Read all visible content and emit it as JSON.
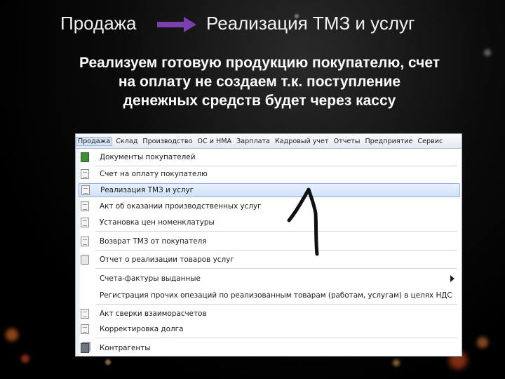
{
  "slide": {
    "header_left": "Продажа",
    "header_right": "Реализация ТМЗ и услуг",
    "subtitle_lines": [
      "Реализуем готовую продукцию покупателю, счет",
      "на оплату не создаем т.к. поступление",
      "денежных средств будет через кассу"
    ]
  },
  "colors": {
    "arrow": "#7b3fb0",
    "highlight": "#cfe0f7",
    "background": "#000000"
  },
  "menubar": {
    "items": [
      "Продажа",
      "Склад",
      "Производство",
      "ОС и НМА",
      "Зарплата",
      "Кадровый учет",
      "Отчеты",
      "Предприятие",
      "Сервис"
    ],
    "active_index": 0
  },
  "dropdown": {
    "items": [
      {
        "label": "Документы покупателей",
        "icon": "journal-icon"
      },
      {
        "label": "Счет на оплату покупателю",
        "icon": "document-icon"
      },
      {
        "label": "Реализация ТМЗ и услуг",
        "icon": "document-icon",
        "highlighted": true
      },
      {
        "label": "Акт об оказании производственных услуг",
        "icon": "document-icon"
      },
      {
        "label": "Установка цен номенклатуры",
        "icon": "document-icon"
      },
      {
        "label": "Возврат ТМЗ от покупателя",
        "icon": "document-icon"
      },
      {
        "label": "Отчет о реализации товаров услуг",
        "icon": "report-icon"
      },
      {
        "label": "Счета-фактуры выданные",
        "icon": "",
        "submenu": true
      },
      {
        "label": "Регистрация прочих опезаций по реализованным товарам (работам, услугам) в целях НДС",
        "icon": ""
      },
      {
        "label": "Акт сверки взаиморасчетов",
        "icon": "document-icon"
      },
      {
        "label": "Корректировка долга",
        "icon": "document-icon"
      },
      {
        "label": "Контрагенты",
        "icon": "directory-icon"
      }
    ]
  }
}
